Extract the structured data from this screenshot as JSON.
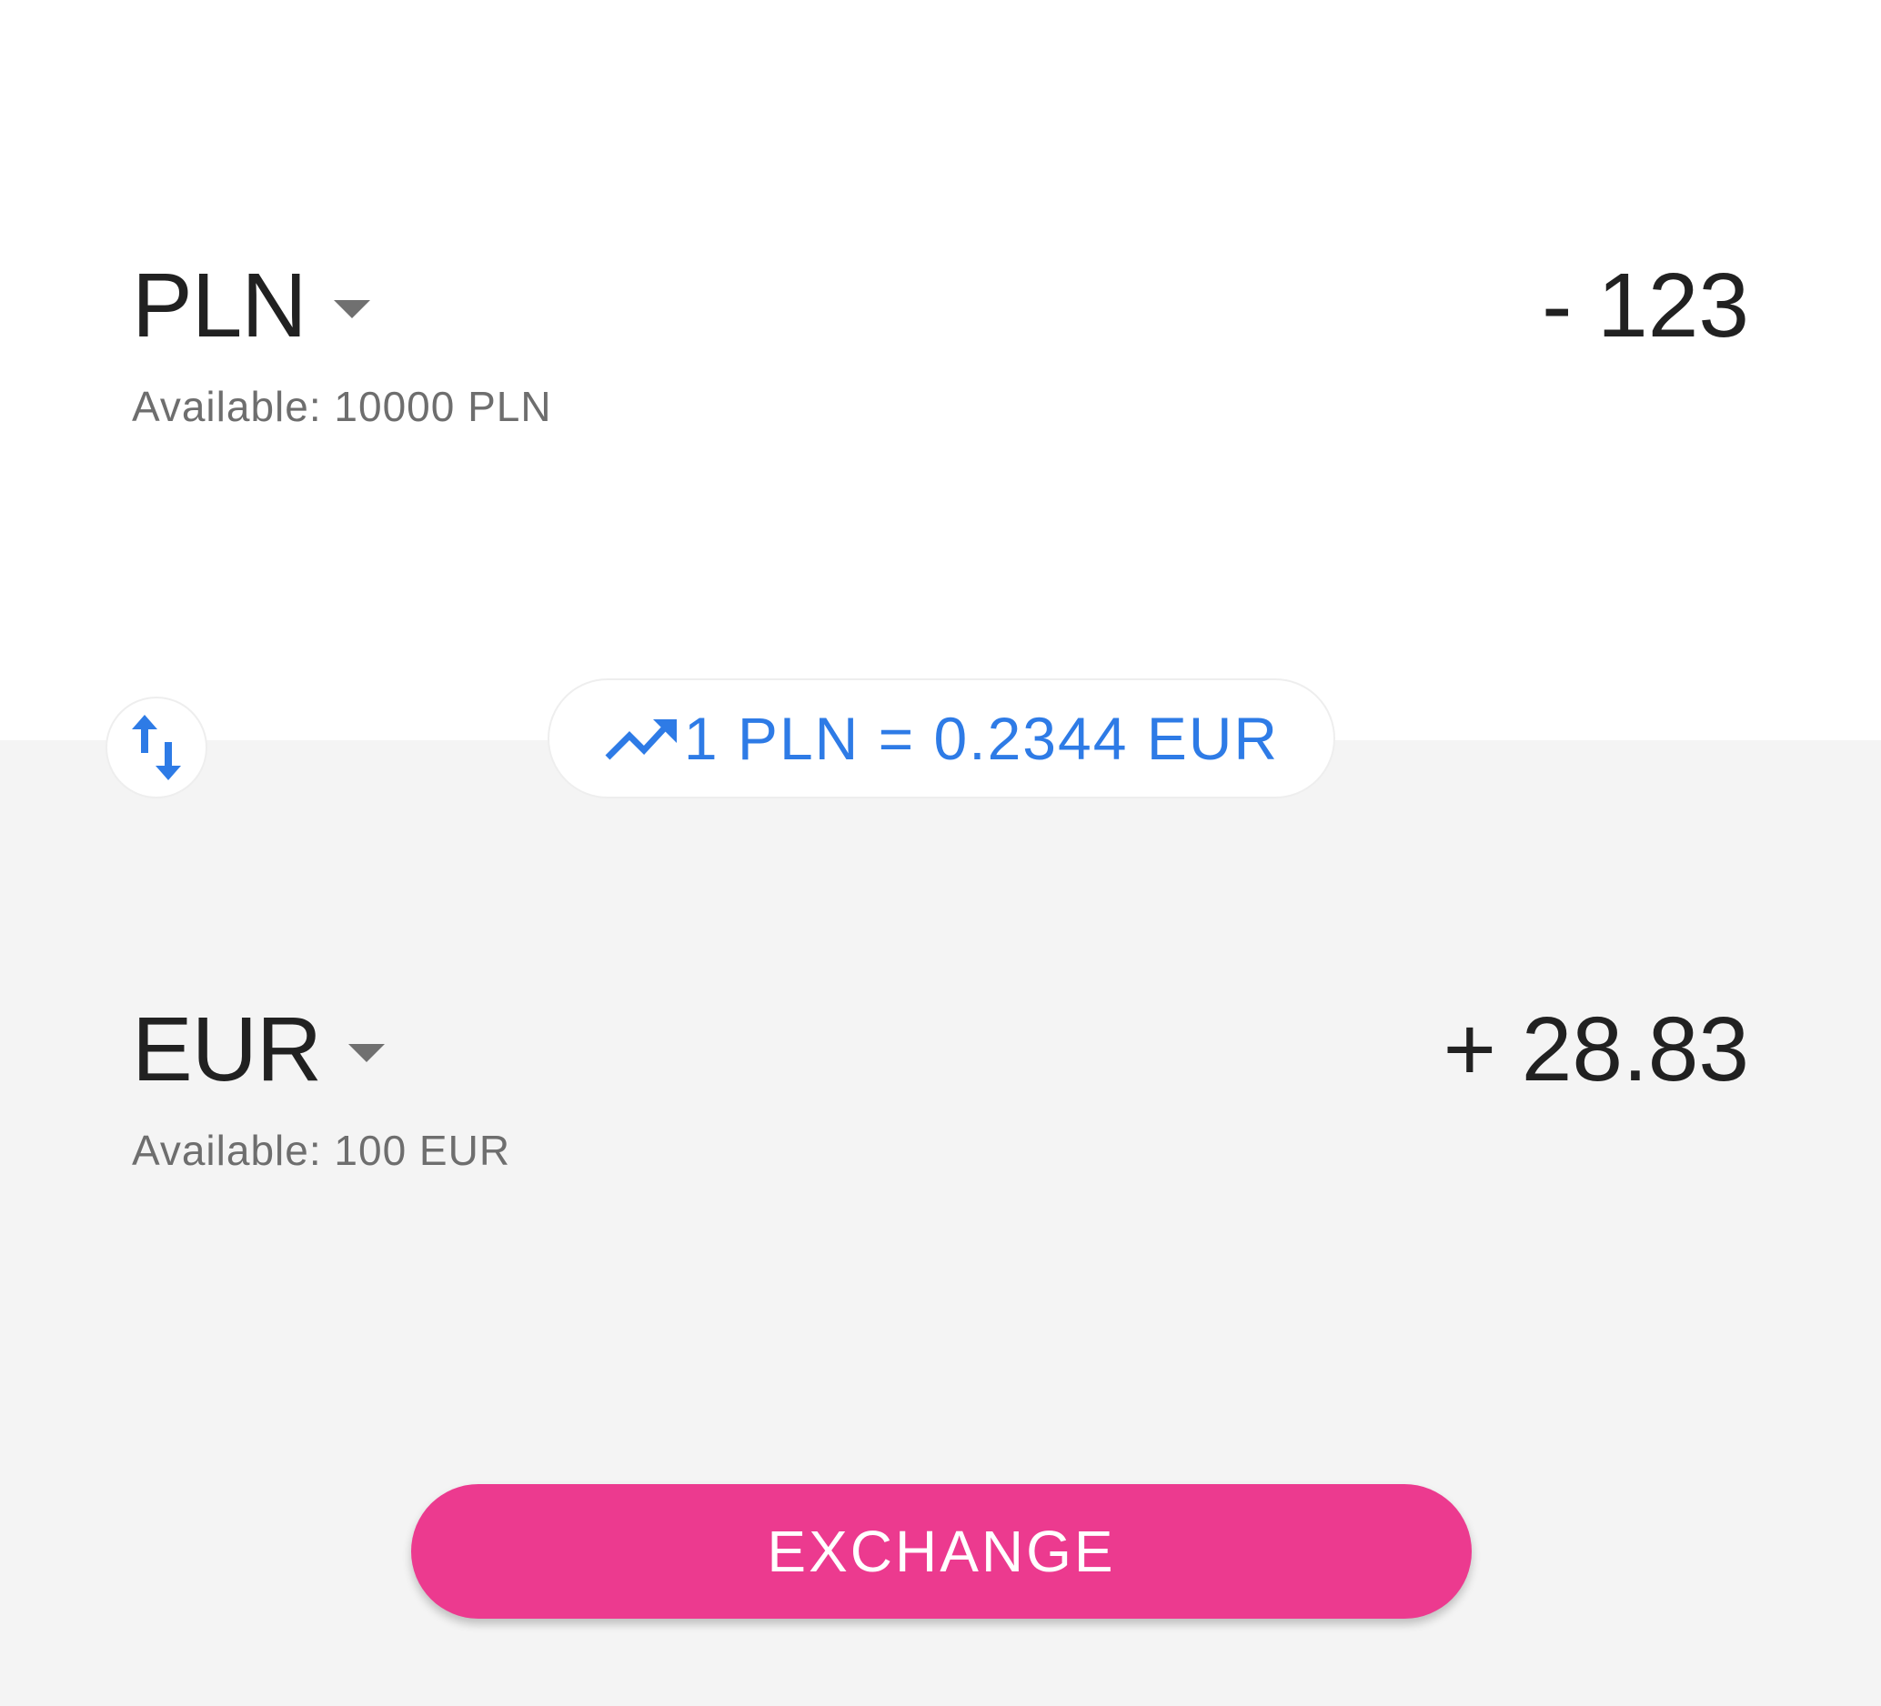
{
  "from": {
    "currency": "PLN",
    "available": "Available: 10000 PLN",
    "amount": "- 123"
  },
  "to": {
    "currency": "EUR",
    "available": "Available: 100 EUR",
    "amount": "+ 28.83"
  },
  "rate": {
    "text": "1 PLN = 0.2344 EUR",
    "icon": "trending-up-icon"
  },
  "swap": {
    "icon": "swap-vertical-icon"
  },
  "actions": {
    "exchange_label": "EXCHANGE"
  },
  "colors": {
    "accent": "#2e7be6",
    "button": "#ec3a8f",
    "bottom_background": "#f4f4f4"
  }
}
